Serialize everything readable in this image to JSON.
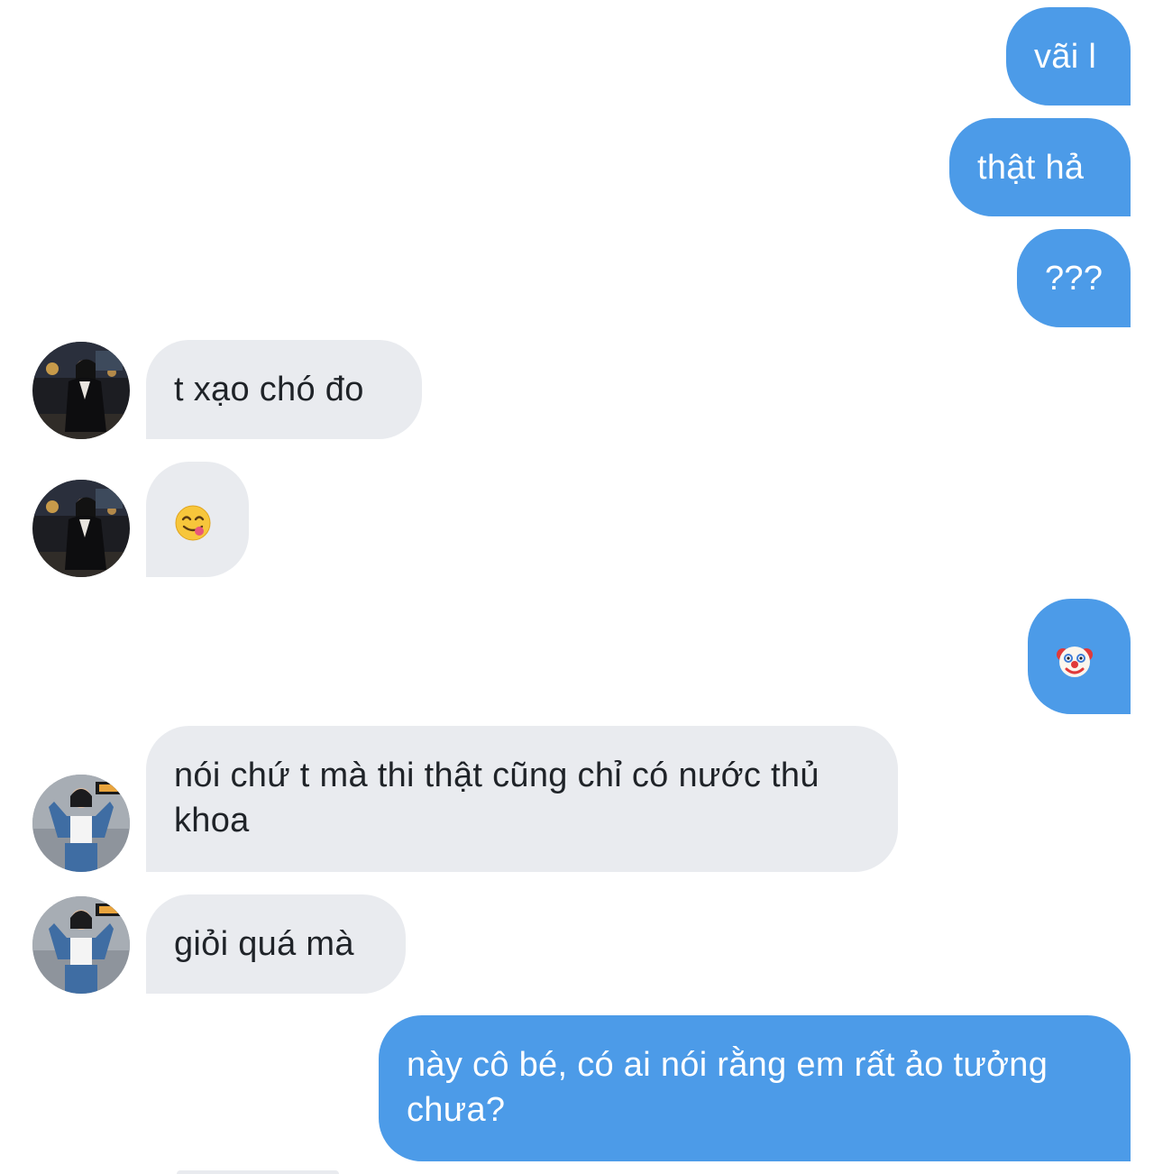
{
  "conversation": {
    "messages": [
      {
        "sender": "me",
        "text": "vãi l"
      },
      {
        "sender": "me",
        "text": "thật hả"
      },
      {
        "sender": "me",
        "text": "???"
      },
      {
        "sender": "them",
        "text": "t xạo chó đo"
      },
      {
        "sender": "them",
        "emoji": "face-savoring-food-emoji"
      },
      {
        "sender": "me",
        "emoji": "clown-face-emoji"
      },
      {
        "sender": "them",
        "text": "nói chứ t mà thi thật cũng chỉ có nước thủ khoa"
      },
      {
        "sender": "them",
        "text": "giỏi quá mà"
      },
      {
        "sender": "me",
        "text": "này cô bé, có ai nói rằng em rất ảo tưởng chưa?"
      }
    ]
  },
  "colors": {
    "sent_bubble": "#4c9be8",
    "received_bubble": "#e9ebef",
    "sent_text": "#ffffff",
    "received_text": "#1f2328",
    "background": "#ffffff"
  }
}
